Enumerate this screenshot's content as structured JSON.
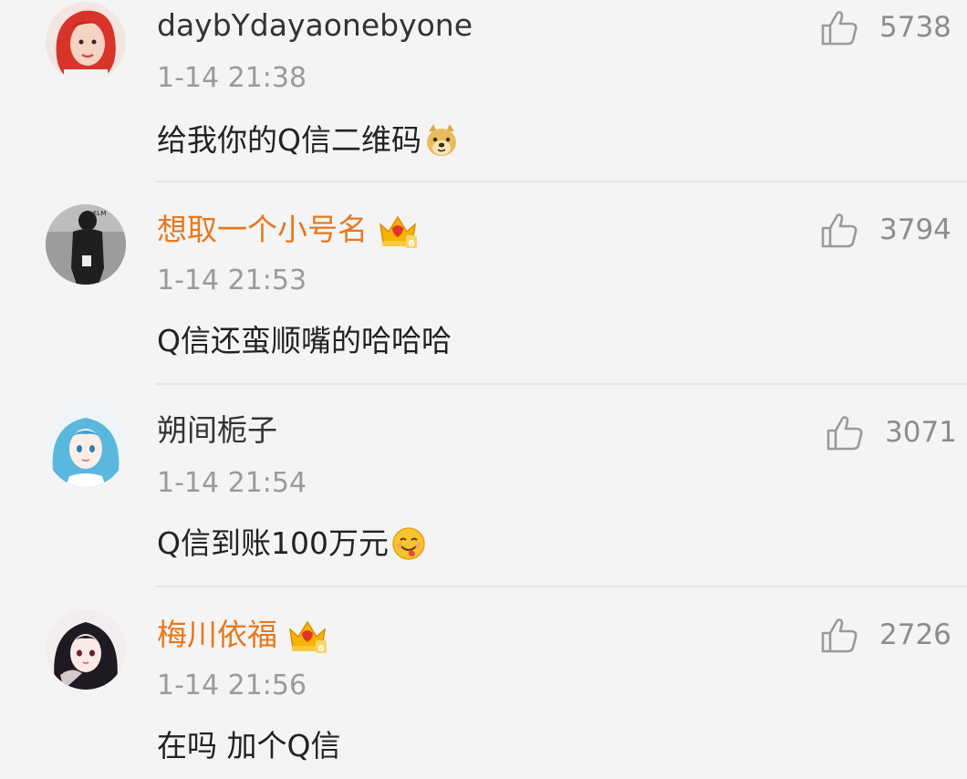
{
  "comments": [
    {
      "username": "daybYdayaonebyone",
      "vip": false,
      "time": "1-14 21:38",
      "text": "给我你的Q信二维码",
      "emoji": "doge-emoji",
      "likes": "5738",
      "avatar": "avatar-red-hair-girl"
    },
    {
      "username": "想取一个小号名",
      "vip": true,
      "time": "1-14 21:53",
      "text": "Q信还蛮顺嘴的哈哈哈",
      "emoji": "",
      "likes": "3794",
      "avatar": "avatar-dark-figure"
    },
    {
      "username": "朔间栀子",
      "vip": false,
      "time": "1-14 21:54",
      "text": "Q信到账100万元",
      "emoji": "tongue-smile-emoji",
      "likes": "3071",
      "avatar": "avatar-blue-hair-anime"
    },
    {
      "username": "梅川依福",
      "vip": true,
      "time": "1-14 21:56",
      "text": "在吗 加个Q信",
      "emoji": "",
      "likes": "2726",
      "avatar": "avatar-dark-hair-anime"
    }
  ],
  "colors": {
    "background": "#f4f4f4",
    "vip_name": "#e8771c",
    "normal_name": "#333333",
    "timestamp": "#9a9a9a",
    "like_count": "#8c8c8c",
    "crown_badge": "#f5b400"
  },
  "icons": {
    "like": "thumbs-up-icon",
    "vip_badge": "crown-vip-icon"
  }
}
